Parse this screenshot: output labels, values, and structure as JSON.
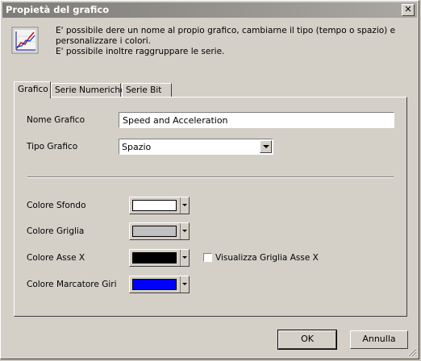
{
  "window": {
    "title": "Propietà del grafico",
    "close_label": "✕"
  },
  "header": {
    "icon": "chart-icon",
    "line1": "E' possibile dere un nome al propio grafico, cambiarne il tipo (tempo o spazio) e",
    "line2": "personalizzare i colori.",
    "line3": "E' possibile inoltre raggruppare le serie."
  },
  "tabs": [
    {
      "label": "Grafico",
      "active": true
    },
    {
      "label": "Serie Numeriche",
      "active": false
    },
    {
      "label": "Serie Bit",
      "active": false
    }
  ],
  "form": {
    "name_label": "Nome Grafico",
    "name_value": "Speed and Acceleration",
    "type_label": "Tipo Grafico",
    "type_value": "Spazio",
    "bg_color_label": "Colore Sfondo",
    "bg_color": "#ffffff",
    "grid_color_label": "Colore Griglia",
    "grid_color": "#c0c0c0",
    "xaxis_color_label": "Colore Asse X",
    "xaxis_color": "#000000",
    "show_xaxis_grid_label": "Visualizza Griglia Asse X",
    "show_xaxis_grid": false,
    "lap_marker_color_label": "Colore Marcatore Giri",
    "lap_marker_color": "#0000ff"
  },
  "buttons": {
    "ok": "OK",
    "cancel": "Annulla"
  }
}
